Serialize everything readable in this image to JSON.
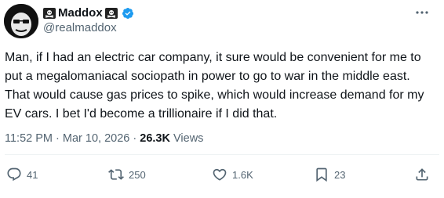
{
  "author": {
    "display_name": "Maddox",
    "handle": "@realmaddox",
    "verified": true
  },
  "icons": {
    "more": "more-icon",
    "reply": "reply-icon",
    "retweet": "retweet-icon",
    "like": "like-icon",
    "bookmark": "bookmark-icon",
    "share": "share-icon",
    "skull_flag": "skull-crossbones-icon",
    "verified": "verified-badge-icon"
  },
  "tweet": {
    "text": "Man, if I had an electric car company, it sure would be convenient for me to put a megalomaniacal sociopath in power to go to war in the middle east. That would cause gas prices to spike, which would increase demand for my EV cars. I bet I'd become a trillionaire if I did that.",
    "time": "11:52 PM",
    "separator": "·",
    "date": "Mar 10, 2026",
    "views_count": "26.3K",
    "views_label": "Views"
  },
  "actions": {
    "reply_count": "41",
    "retweet_count": "250",
    "like_count": "1.6K",
    "bookmark_count": "23"
  },
  "colors": {
    "text": "#0f1419",
    "secondary": "#536471",
    "verified": "#1d9bf0",
    "divider": "#eff3f4"
  }
}
